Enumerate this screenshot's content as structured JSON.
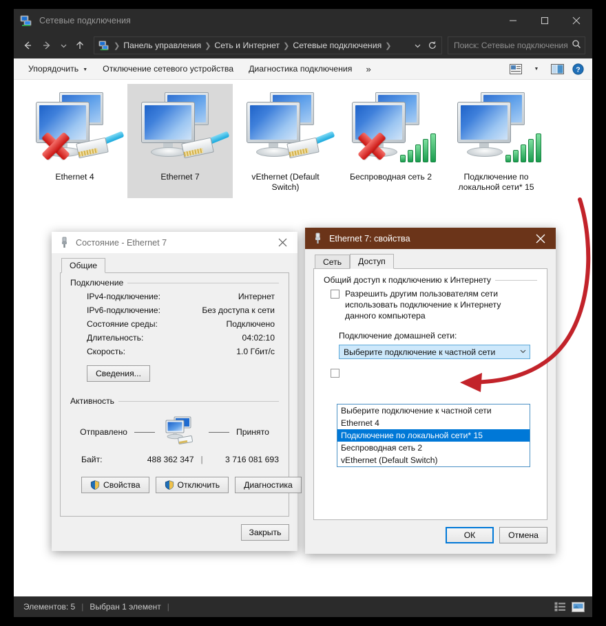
{
  "window": {
    "title": "Сетевые подключения",
    "title_icon": "network-connections-icon",
    "minimize": "minimize-icon",
    "maximize": "maximize-icon",
    "close": "close-icon"
  },
  "addressbar": {
    "back_icon": "back-arrow-icon",
    "forward_icon": "forward-arrow-icon",
    "recent_icon": "chevron-down-icon",
    "up_icon": "up-arrow-icon",
    "path_icon": "network-connections-icon",
    "crumbs": [
      "Панель управления",
      "Сеть и Интернет",
      "Сетевые подключения"
    ],
    "dropdown_icon": "chevron-down-icon",
    "refresh_icon": "refresh-icon",
    "search_placeholder": "Поиск: Сетевые подключения",
    "search_value": "",
    "search_icon": "search-icon"
  },
  "commandbar": {
    "items": [
      {
        "label": "Упорядочить",
        "has_caret": true
      },
      {
        "label": "Отключение сетевого устройства",
        "has_caret": false
      },
      {
        "label": "Диагностика подключения",
        "has_caret": false
      }
    ],
    "overflow": "»",
    "view_icon": "view-layout-icon",
    "view_caret_icon": "chevron-down-icon",
    "preview_pane_icon": "preview-pane-icon",
    "help_icon": "help-icon"
  },
  "connections": [
    {
      "label": "Ethernet 4",
      "selected": false,
      "state": "disconnected",
      "media": "ethernet"
    },
    {
      "label": "Ethernet 7",
      "selected": true,
      "state": "connected",
      "media": "ethernet"
    },
    {
      "label": "vEthernet (Default Switch)",
      "selected": false,
      "state": "connected",
      "media": "ethernet"
    },
    {
      "label": "Беспроводная сеть 2",
      "selected": false,
      "state": "disconnected",
      "media": "wifi"
    },
    {
      "label": "Подключение по локальной сети* 15",
      "selected": false,
      "state": "connected",
      "media": "wifi"
    }
  ],
  "statusbar": {
    "items_count": "Элементов: 5",
    "selection": "Выбран 1 элемент",
    "details_view_icon": "details-view-icon",
    "large_icons_view_icon": "large-icons-view-icon"
  },
  "status_dialog": {
    "title": "Состояние - Ethernet 7",
    "title_icon": "network-plug-icon",
    "close_icon": "close-icon",
    "tabs": [
      {
        "label": "Общие",
        "active": true
      }
    ],
    "connection_group": "Подключение",
    "connection_rows": [
      {
        "key": "IPv4-подключение:",
        "value": "Интернет"
      },
      {
        "key": "IPv6-подключение:",
        "value": "Без доступа к сети"
      },
      {
        "key": "Состояние среды:",
        "value": "Подключено"
      },
      {
        "key": "Длительность:",
        "value": "04:02:10"
      },
      {
        "key": "Скорость:",
        "value": "1.0 Гбит/с"
      }
    ],
    "details_button": "Сведения...",
    "activity_group": "Активность",
    "sent_label": "Отправлено",
    "received_label": "Принято",
    "bytes_label": "Байт:",
    "bytes_sent": "488 362 347",
    "bytes_received": "3 716 081 693",
    "activity_icon": "network-activity-icon",
    "buttons": [
      {
        "label": "Свойства",
        "shield": true
      },
      {
        "label": "Отключить",
        "shield": true
      },
      {
        "label": "Диагностика",
        "shield": false
      }
    ],
    "close_button": "Закрыть"
  },
  "properties_dialog": {
    "title": "Ethernet 7: свойства",
    "title_icon": "network-plug-icon",
    "close_icon": "close-icon",
    "title_color": "#6b3419",
    "tabs": [
      {
        "label": "Сеть",
        "active": false
      },
      {
        "label": "Доступ",
        "active": true
      }
    ],
    "group_title": "Общий доступ к подключению к Интернету",
    "share_checkbox_label": "Разрешить другим пользователям сети использовать подключение к Интернету данного компьютера",
    "share_checked": false,
    "home_network_label": "Подключение домашней сети:",
    "combo_value": "Выберите подключение к частной сети",
    "combo_caret_icon": "chevron-down-icon",
    "dropdown_options": [
      {
        "label": "Выберите подключение к частной сети",
        "selected": false
      },
      {
        "label": "Ethernet 4",
        "selected": false
      },
      {
        "label": "Подключение по локальной сети* 15",
        "selected": true
      },
      {
        "label": "Беспроводная сеть 2",
        "selected": false
      },
      {
        "label": "vEthernet (Default Switch)",
        "selected": false
      }
    ],
    "hidden_checkbox": "second-share-checkbox",
    "ok_button": "ОК",
    "cancel_button": "Отмена"
  },
  "annotation": {
    "arrow": "red-curved-arrow",
    "color": "#c2232a"
  }
}
